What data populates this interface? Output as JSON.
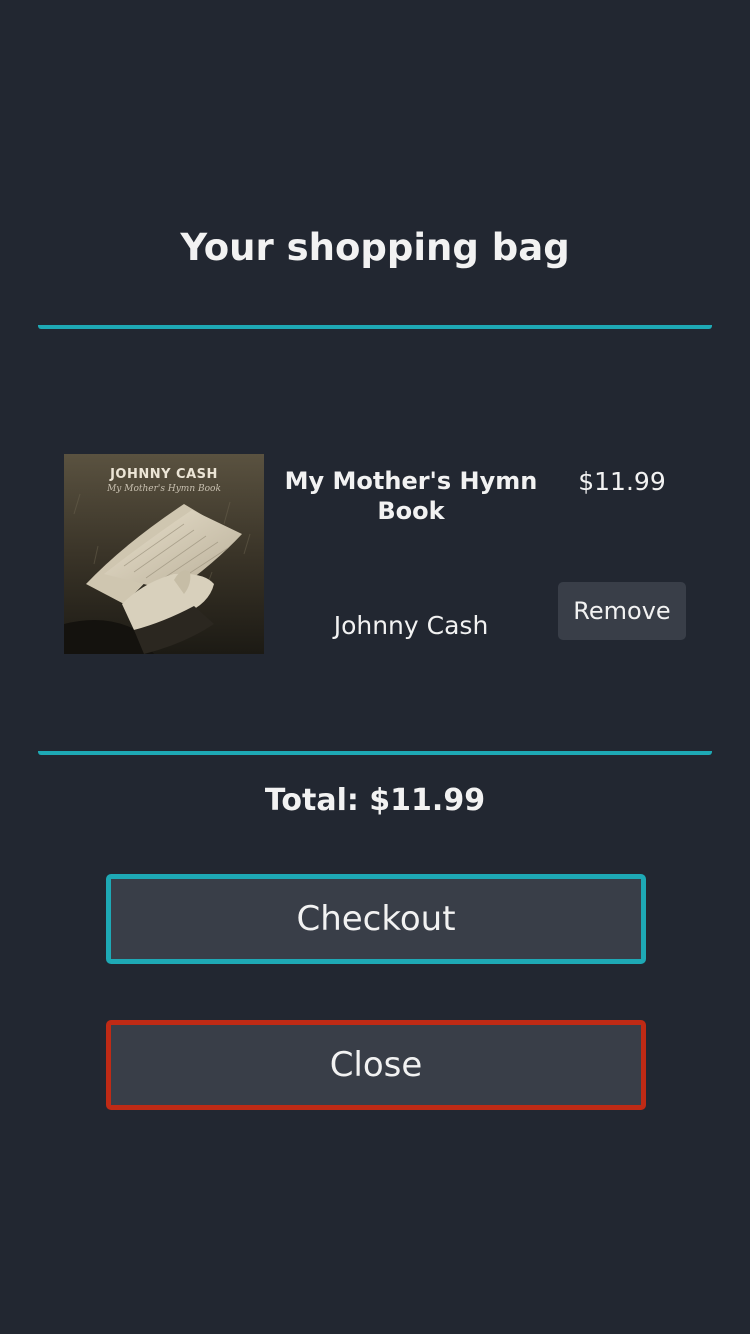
{
  "header": {
    "title": "Your shopping bag"
  },
  "cart": {
    "items": [
      {
        "cover": {
          "artist_text": "JOHNNY CASH",
          "album_text": "My Mother's Hymn Book"
        },
        "title": "My Mother's Hymn Book",
        "artist": "Johnny Cash",
        "price": "$11.99",
        "remove_label": "Remove"
      }
    ],
    "total_label": "Total: $11.99"
  },
  "actions": {
    "checkout_label": "Checkout",
    "close_label": "Close"
  },
  "colors": {
    "background": "#222731",
    "accent": "#1ea9b5",
    "danger": "#bf2a15",
    "button_bg": "#393e48",
    "text": "#f2f2f2"
  }
}
